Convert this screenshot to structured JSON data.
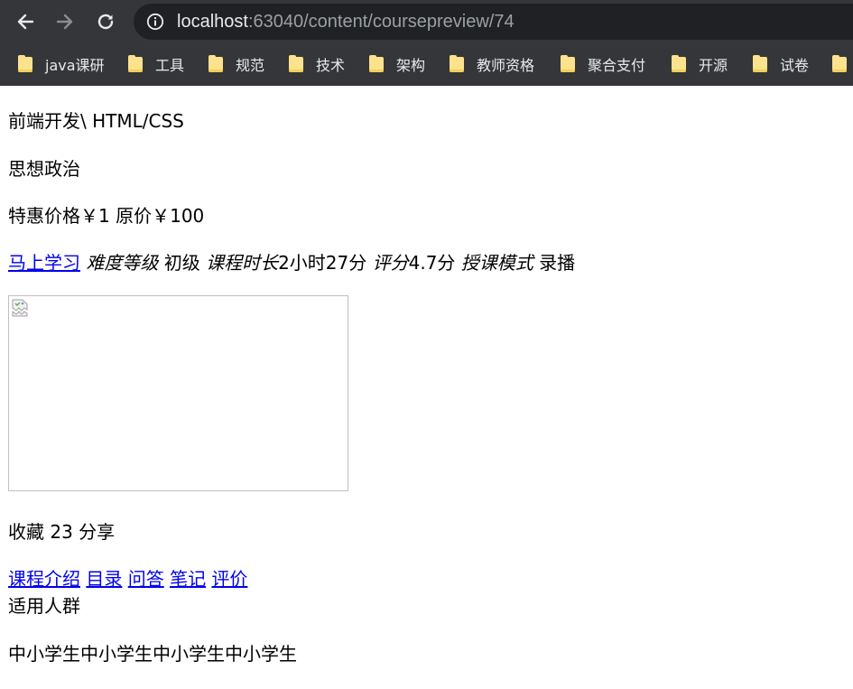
{
  "browser": {
    "url_host": "localhost",
    "url_rest": ":63040/content/coursepreview/74",
    "bookmarks": [
      {
        "label": "java课研"
      },
      {
        "label": "工具"
      },
      {
        "label": "规范"
      },
      {
        "label": "技术"
      },
      {
        "label": "架构"
      },
      {
        "label": "教师资格"
      },
      {
        "label": "聚合支付"
      },
      {
        "label": "开源"
      },
      {
        "label": "试卷"
      }
    ]
  },
  "course": {
    "category": "前端开发\\ HTML/CSS",
    "name": "思想政治",
    "price_label": "特惠价格",
    "price_value": "￥1",
    "orig_label": "原价",
    "orig_value": "￥100",
    "study_link": "马上学习",
    "difficulty_label": "难度等级",
    "difficulty_value": "初级",
    "duration_label": "课程时长",
    "duration_value": "2小时27分",
    "rating_label": "评分",
    "rating_value": "4.7分",
    "mode_label": "授课模式",
    "mode_value": "录播",
    "favorite_label": "收藏",
    "favorite_count": "23",
    "share_label": "分享"
  },
  "tabs": [
    "课程介绍",
    "目录",
    "问答",
    "笔记",
    "评价"
  ],
  "audience": {
    "heading": "适用人群",
    "text": "中小学生中小学生中小学生中小学生"
  }
}
